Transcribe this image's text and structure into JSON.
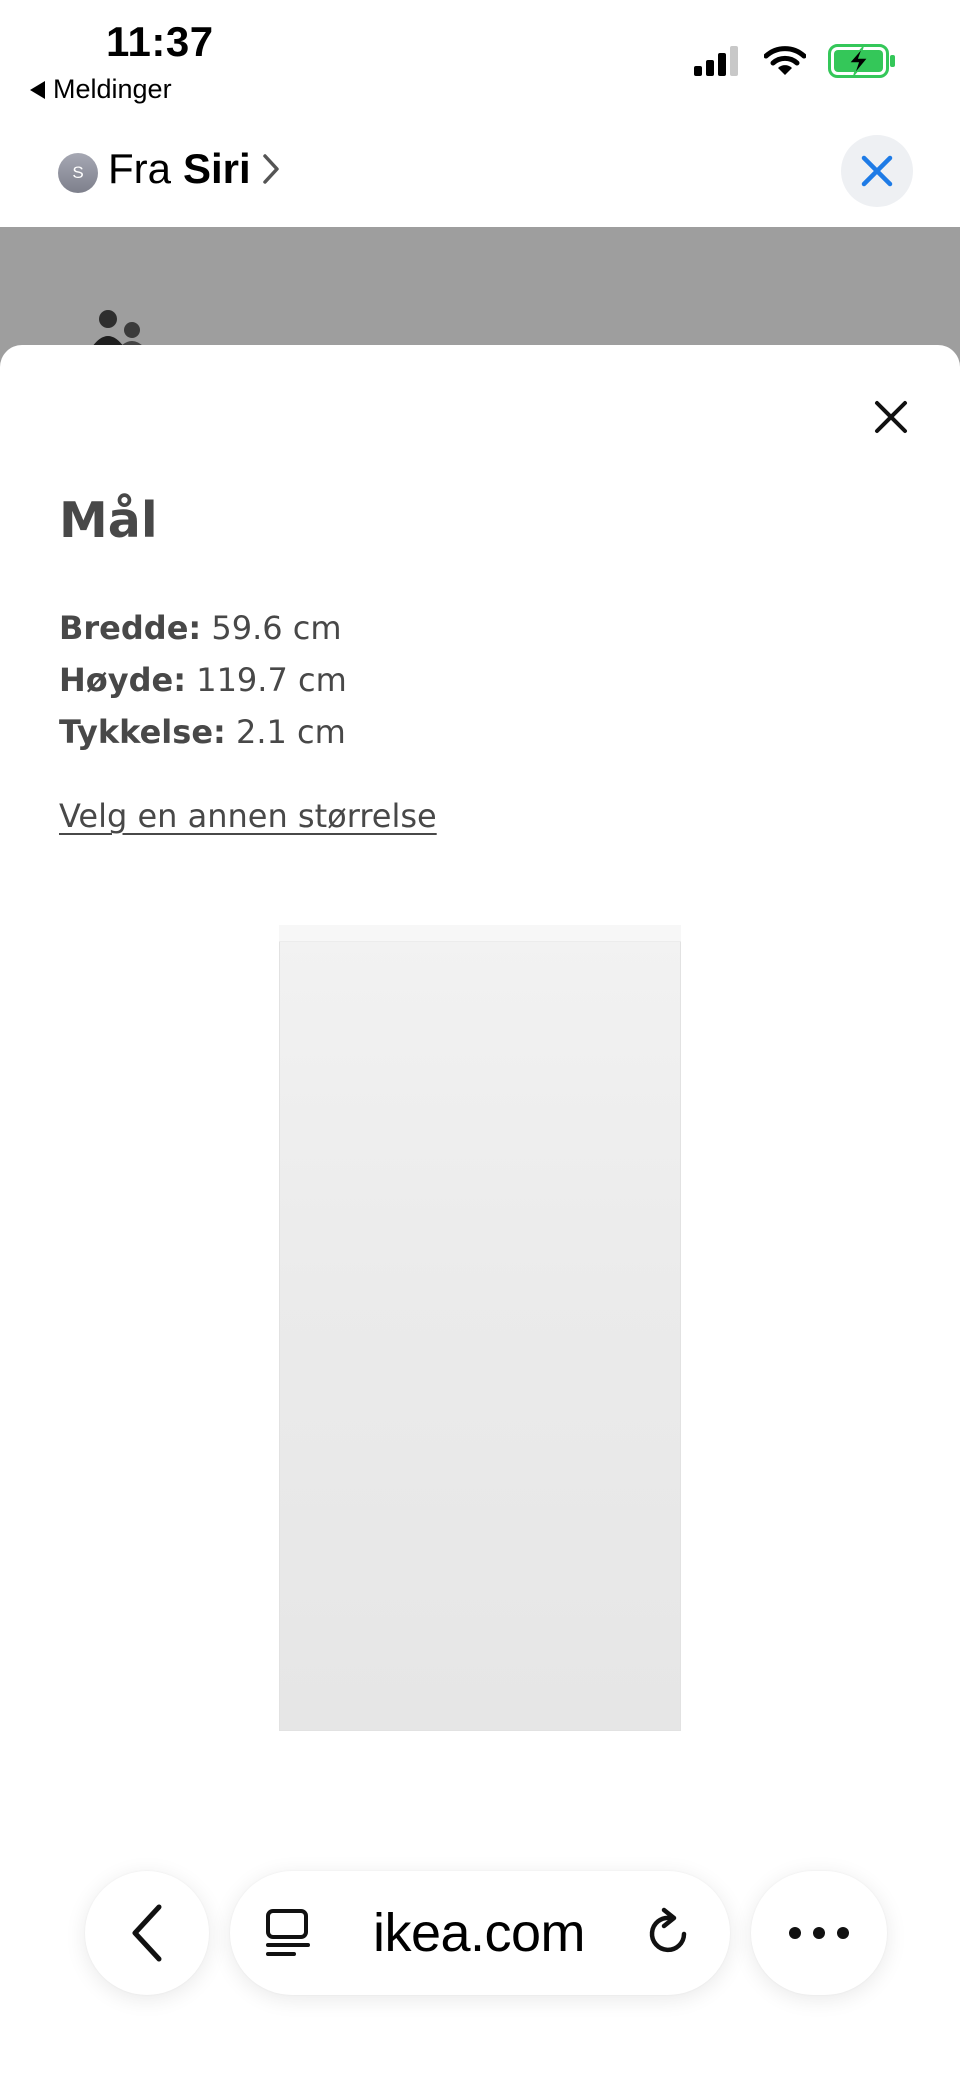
{
  "status_bar": {
    "time": "11:37",
    "back_app_label": "Meldinger",
    "battery_color": "#34c759"
  },
  "message_header": {
    "avatar_initial": "S",
    "prefix": "Fra",
    "sender": "Siri"
  },
  "sheet": {
    "title": "Mål",
    "dimensions": [
      {
        "label": "Bredde:",
        "value": "59.6 cm"
      },
      {
        "label": "Høyde:",
        "value": "119.7 cm"
      },
      {
        "label": "Tykkelse:",
        "value": "2.1 cm"
      }
    ],
    "change_size_link": "Velg en annen størrelse"
  },
  "toolbar": {
    "domain": "ikea.com",
    "accent_color": "#1e7be6"
  }
}
